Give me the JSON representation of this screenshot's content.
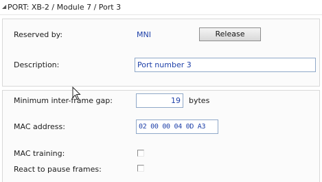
{
  "header": {
    "title": "PORT: XB-2 / Module 7 / Port 3",
    "icon": "collapse-triangle-icon"
  },
  "reserved": {
    "label": "Reserved by:",
    "value": "MNI",
    "button_label": "Release"
  },
  "description": {
    "label": "Description:",
    "value": "Port number 3"
  },
  "ifg": {
    "label": "Minimum inter-frame gap:",
    "value": "19",
    "units": "bytes"
  },
  "mac": {
    "label": "MAC address:",
    "value": "02 00 00 04 0D A3"
  },
  "mac_training": {
    "label": "MAC training:",
    "checked": false
  },
  "pause_frames": {
    "label": "React to pause frames:",
    "checked": false
  },
  "colors": {
    "value_text": "#1d3fa8",
    "input_border": "#8fa8c8"
  }
}
